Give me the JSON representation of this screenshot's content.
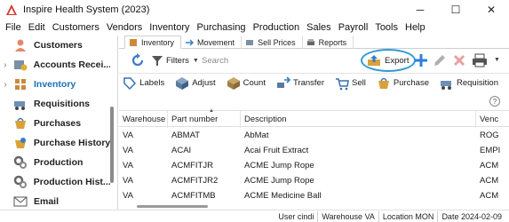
{
  "window": {
    "title": "Inspire Health System (2023)",
    "minimize": "─",
    "maximize": "☐",
    "close": "✕"
  },
  "menu": [
    "File",
    "Edit",
    "Customers",
    "Vendors",
    "Inventory",
    "Purchasing",
    "Production",
    "Sales",
    "Payroll",
    "Tools",
    "Help"
  ],
  "sidebar": {
    "items": [
      {
        "label": "Customers",
        "icon": "customers-icon",
        "chevron": ""
      },
      {
        "label": "Accounts Recei...",
        "icon": "accounts-receivable-icon",
        "chevron": "›"
      },
      {
        "label": "Inventory",
        "icon": "inventory-icon",
        "chevron": "›"
      },
      {
        "label": "Requisitions",
        "icon": "requisitions-icon",
        "chevron": ""
      },
      {
        "label": "Purchases",
        "icon": "purchases-icon",
        "chevron": ""
      },
      {
        "label": "Purchase History",
        "icon": "purchase-history-icon",
        "chevron": ""
      },
      {
        "label": "Production",
        "icon": "production-icon",
        "chevron": ""
      },
      {
        "label": "Production Hist...",
        "icon": "production-history-icon",
        "chevron": ""
      },
      {
        "label": "Email",
        "icon": "email-icon",
        "chevron": ""
      }
    ],
    "active_index": 2
  },
  "tabs": [
    {
      "label": "Inventory",
      "icon": "inventory-tab-icon"
    },
    {
      "label": "Movement",
      "icon": "movement-icon"
    },
    {
      "label": "Sell Prices",
      "icon": "sell-prices-icon"
    },
    {
      "label": "Reports",
      "icon": "reports-icon"
    }
  ],
  "toolbar": {
    "filters_label": "Filters",
    "search_placeholder": "Search",
    "export_label": "Export"
  },
  "actions": [
    {
      "label": "Labels",
      "icon": "labels-icon"
    },
    {
      "label": "Adjust",
      "icon": "adjust-icon"
    },
    {
      "label": "Count",
      "icon": "count-icon"
    },
    {
      "label": "Transfer",
      "icon": "transfer-icon"
    },
    {
      "label": "Sell",
      "icon": "sell-icon"
    },
    {
      "label": "Purchase",
      "icon": "purchase-icon"
    },
    {
      "label": "Requisition",
      "icon": "requisition-icon"
    }
  ],
  "grid": {
    "columns": [
      "Warehouse",
      "Part number",
      "Description",
      "Venc"
    ],
    "rows": [
      [
        "VA",
        "ABMAT",
        "AbMat",
        "ROG"
      ],
      [
        "VA",
        "ACAI",
        "Acai Fruit Extract",
        "EMPI"
      ],
      [
        "VA",
        "ACMFITJR",
        "ACME Jump Rope",
        "ACM"
      ],
      [
        "VA",
        "ACMFITJR2",
        "ACME Jump Rope",
        "ACM"
      ],
      [
        "VA",
        "ACMFITMB",
        "ACME Medicine Ball",
        "ACM"
      ]
    ]
  },
  "status": [
    "User cindi",
    "Warehouse VA",
    "Location MON",
    "Date 2024-02-09"
  ],
  "colors": {
    "accent": "#1a6fb5",
    "highlight_ring": "#2f9ad8"
  }
}
